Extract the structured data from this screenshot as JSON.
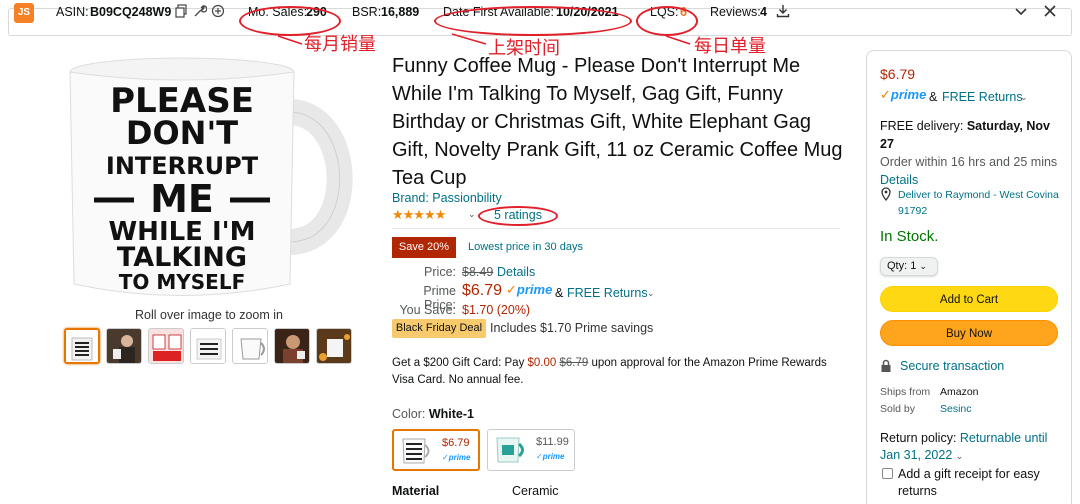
{
  "extension_bar": {
    "logo": "JS",
    "asin_label": "ASIN:",
    "asin_value": "B09CQ248W9",
    "mo_sales_label": "Mo. Sales:",
    "mo_sales_value": "290",
    "bsr_label": "BSR:",
    "bsr_value": "16,889",
    "date_label": "Date First Available:",
    "date_value": "10/20/2021",
    "lqs_label": "LQS:",
    "lqs_value": "6",
    "reviews_label": "Reviews:",
    "reviews_value": "4",
    "icons": [
      "copy-icon",
      "wrench-icon",
      "add-circle-icon",
      "download-icon",
      "chevron-down-icon",
      "close-icon"
    ]
  },
  "annotations": {
    "mo_sales_cn": "每月销量",
    "date_cn": "上架时间",
    "lqs_cn": "每日单量",
    "color": "#e0202a"
  },
  "gallery": {
    "mug_lines": [
      "PLEASE",
      "DON'T",
      "INTERRUPT",
      "ME",
      "WHILE I'M",
      "TALKING",
      "TO MYSELF"
    ],
    "zoom_hint": "Roll over image to zoom in",
    "thumbnails": [
      "thumb-1",
      "thumb-2",
      "thumb-3",
      "thumb-4",
      "thumb-5",
      "thumb-6",
      "thumb-7"
    ]
  },
  "product": {
    "title": "Funny Coffee Mug - Please Don't Interrupt Me While I'm Talking To Myself, Gag Gift, Funny Birthday or Christmas Gift, White Elephant Gag Gift, Novelty Prank Gift, 11 oz Ceramic Coffee Mug Tea Cup",
    "brand": "Brand: Passionbility",
    "stars": "★★★★★",
    "ratings": "5 ratings",
    "save_badge": "Save 20%",
    "lowest_price": "Lowest price in 30 days",
    "price_label": "Price:",
    "list_price": "$8.49",
    "details_link": "Details",
    "prime_price_label": "Prime Price:",
    "prime_price": "$6.79",
    "prime": "prime",
    "amp": "&",
    "free_returns": "FREE Returns",
    "you_save_label": "You Save:",
    "you_save": "$1.70 (20%)",
    "black_friday": "Black Friday Deal",
    "includes": "Includes $1.70 Prime savings",
    "giftcard_pre": "Get a $200 Gift Card: Pay ",
    "giftcard_zero": "$0.00",
    "giftcard_strike": "$6.79",
    "giftcard_post": " upon approval for the Amazon Prime Rewards Visa Card. No annual fee.",
    "color_label": "Color:",
    "color_value": "White-1",
    "variants": [
      {
        "price": "$6.79",
        "prime": "✓prime",
        "price_color": "#b12704"
      },
      {
        "price": "$11.99",
        "prime": "✓prime",
        "price_color": "#565959"
      }
    ],
    "material_label": "Material",
    "material_value": "Ceramic"
  },
  "buybox": {
    "price": "$6.79",
    "prime": "prime",
    "amp": "&",
    "free_returns": "FREE Returns",
    "delivery_pre": "FREE delivery: ",
    "delivery_date": "Saturday, Nov 27",
    "order_within": "Order within 16 hrs and 25 mins",
    "details": "Details",
    "deliver_to": "Deliver to Raymond - West Covina 91792",
    "in_stock": "In Stock.",
    "qty": "Qty: 1",
    "add_to_cart": "Add to Cart",
    "buy_now": "Buy Now",
    "secure": "Secure transaction",
    "ships_from_label": "Ships from",
    "ships_from_value": "Amazon",
    "sold_by_label": "Sold by",
    "sold_by_value": "Sesinc",
    "return_label": "Return policy: ",
    "return_value": "Returnable until Jan 31, 2022",
    "gift_receipt": "Add a gift receipt for easy returns"
  }
}
